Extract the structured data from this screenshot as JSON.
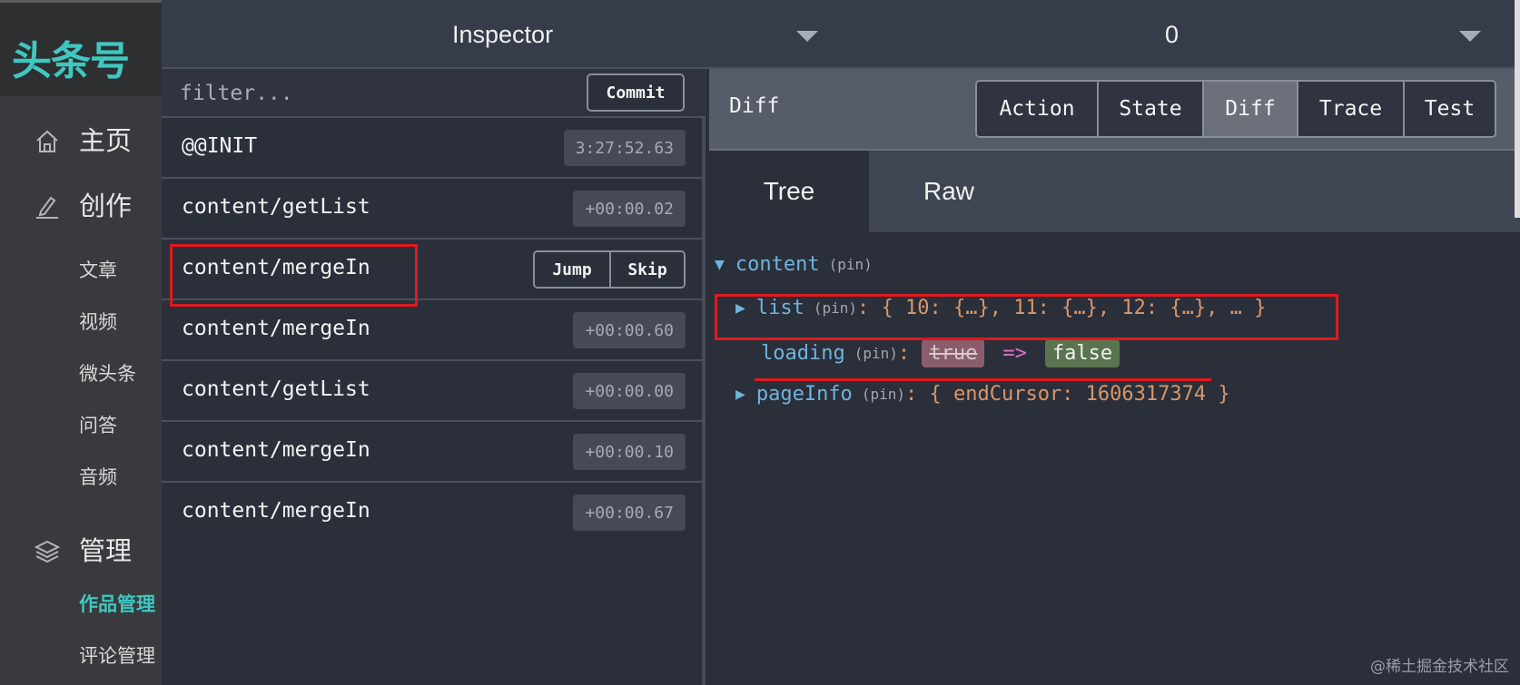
{
  "sidebar": {
    "logo": "头条号",
    "items": [
      {
        "label": "主页",
        "icon": "home-icon"
      },
      {
        "label": "创作",
        "icon": "pencil-icon"
      },
      {
        "label": "管理",
        "icon": "layers-icon"
      }
    ],
    "create_sub": [
      "文章",
      "视频",
      "微头条",
      "问答",
      "音频"
    ],
    "manage_sub": [
      "作品管理",
      "评论管理"
    ],
    "active_sub": "作品管理"
  },
  "topbar": {
    "monitor_select": "Inspector",
    "instance_select": "0"
  },
  "actions": {
    "filter_placeholder": "filter...",
    "commit_label": "Commit",
    "jump_label": "Jump",
    "skip_label": "Skip",
    "rows": [
      {
        "name": "@@INIT",
        "time": "3:27:52.63"
      },
      {
        "name": "content/getList",
        "time": "+00:00.02"
      },
      {
        "name": "content/mergeIn",
        "time": ""
      },
      {
        "name": "content/mergeIn",
        "time": "+00:00.60"
      },
      {
        "name": "content/getList",
        "time": "+00:00.00"
      },
      {
        "name": "content/mergeIn",
        "time": "+00:00.10"
      },
      {
        "name": "content/mergeIn",
        "time": "+00:00.67"
      }
    ]
  },
  "monitor": {
    "title": "Diff",
    "tabs": [
      "Action",
      "State",
      "Diff",
      "Trace",
      "Test"
    ],
    "active_tab": "Diff",
    "subtabs": [
      "Tree",
      "Raw"
    ],
    "active_subtab": "Tree"
  },
  "tree": {
    "root_key": "content",
    "pin": "(pin)",
    "list_key": "list",
    "list_value": "{ 10: {…}, 11: {…}, 12: {…}, … }",
    "loading_key": "loading",
    "loading_old": "true",
    "loading_arrow": "=>",
    "loading_new": "false",
    "pageinfo_key": "pageInfo",
    "pageinfo_value": "{ endCursor: 1606317374 }"
  },
  "watermark": "@稀土掘金技术社区",
  "colors": {
    "accent": "#3ec8c0",
    "annotation": "#e0191d",
    "key": "#6fb4dc",
    "value": "#d9966b"
  }
}
